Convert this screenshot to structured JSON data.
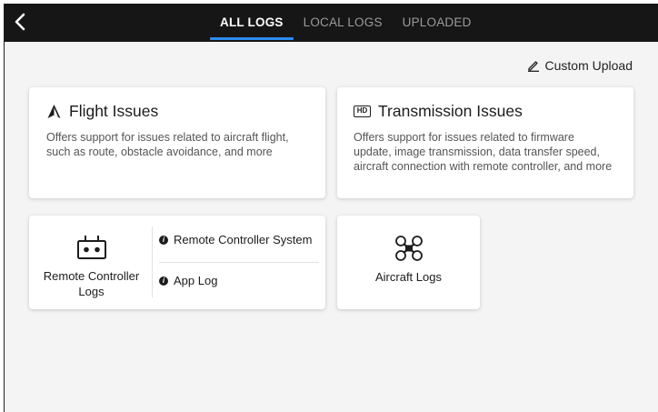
{
  "header": {
    "back_icon": "chevron-left-icon",
    "tabs": [
      {
        "label": "ALL LOGS",
        "active": true
      },
      {
        "label": "LOCAL LOGS",
        "active": false
      },
      {
        "label": "UPLOADED",
        "active": false
      }
    ],
    "accent_color": "#2d8cf0"
  },
  "custom_upload": {
    "label": "Custom Upload",
    "icon": "pencil-icon"
  },
  "cards": {
    "flight": {
      "icon": "aircraft-arrow-icon",
      "title": "Flight Issues",
      "description": "Offers support for issues related to aircraft flight, such as route, obstacle avoidance, and more"
    },
    "transmission": {
      "icon": "hd-icon",
      "icon_text": "HD",
      "title": "Transmission Issues",
      "description": "Offers support for issues related to firmware update, image transmission, data transfer speed, aircraft connection with remote controller, and more"
    },
    "remote_controller": {
      "icon": "remote-controller-icon",
      "label": "Remote Controller Logs",
      "items": [
        {
          "label": "Remote Controller System",
          "icon": "info-icon"
        },
        {
          "label": "App Log",
          "icon": "info-icon"
        }
      ]
    },
    "aircraft": {
      "icon": "drone-icon",
      "label": "Aircraft Logs"
    }
  }
}
